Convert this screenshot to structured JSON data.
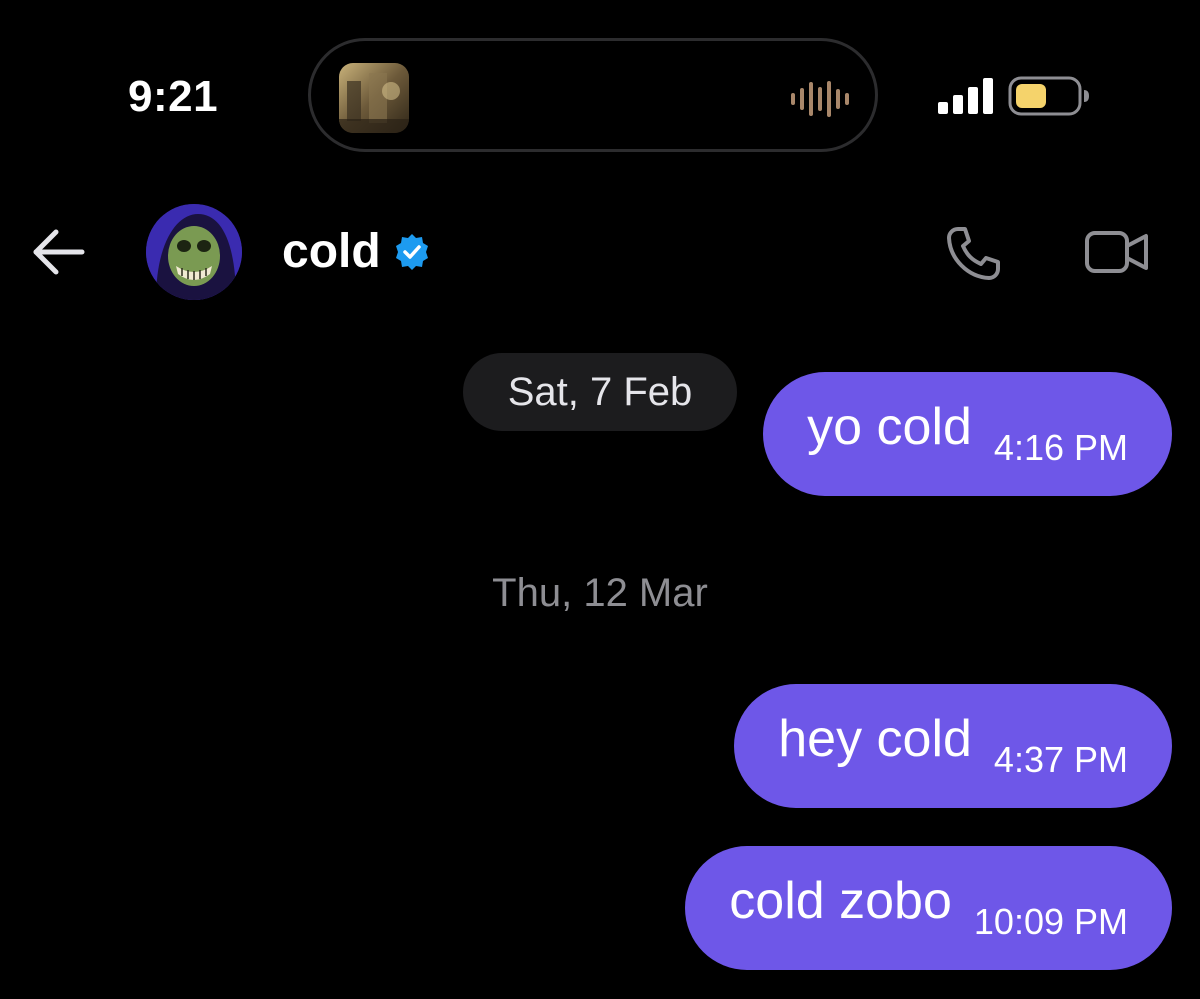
{
  "status_bar": {
    "time": "9:21",
    "battery_color": "#f5d36b"
  },
  "header": {
    "contact_name": "cold",
    "verified_color": "#1d9bf0"
  },
  "conversation": {
    "accent_color": "#6e57e8",
    "groups": [
      {
        "date_label": "Sat, 7 Feb",
        "messages": [
          {
            "text": "yo cold",
            "time": "4:16 PM"
          }
        ]
      },
      {
        "date_label": "Thu, 12 Mar",
        "messages": [
          {
            "text": "hey cold",
            "time": "4:37 PM"
          },
          {
            "text": "cold zobo",
            "time": "10:09 PM"
          }
        ]
      }
    ]
  },
  "icons": {
    "back": "arrow-left-icon",
    "verified": "verified-badge-icon",
    "call": "phone-icon",
    "video_call": "video-camera-icon",
    "signal": "cellular-signal-icon",
    "battery": "battery-icon",
    "now_playing": "waveform-icon"
  }
}
